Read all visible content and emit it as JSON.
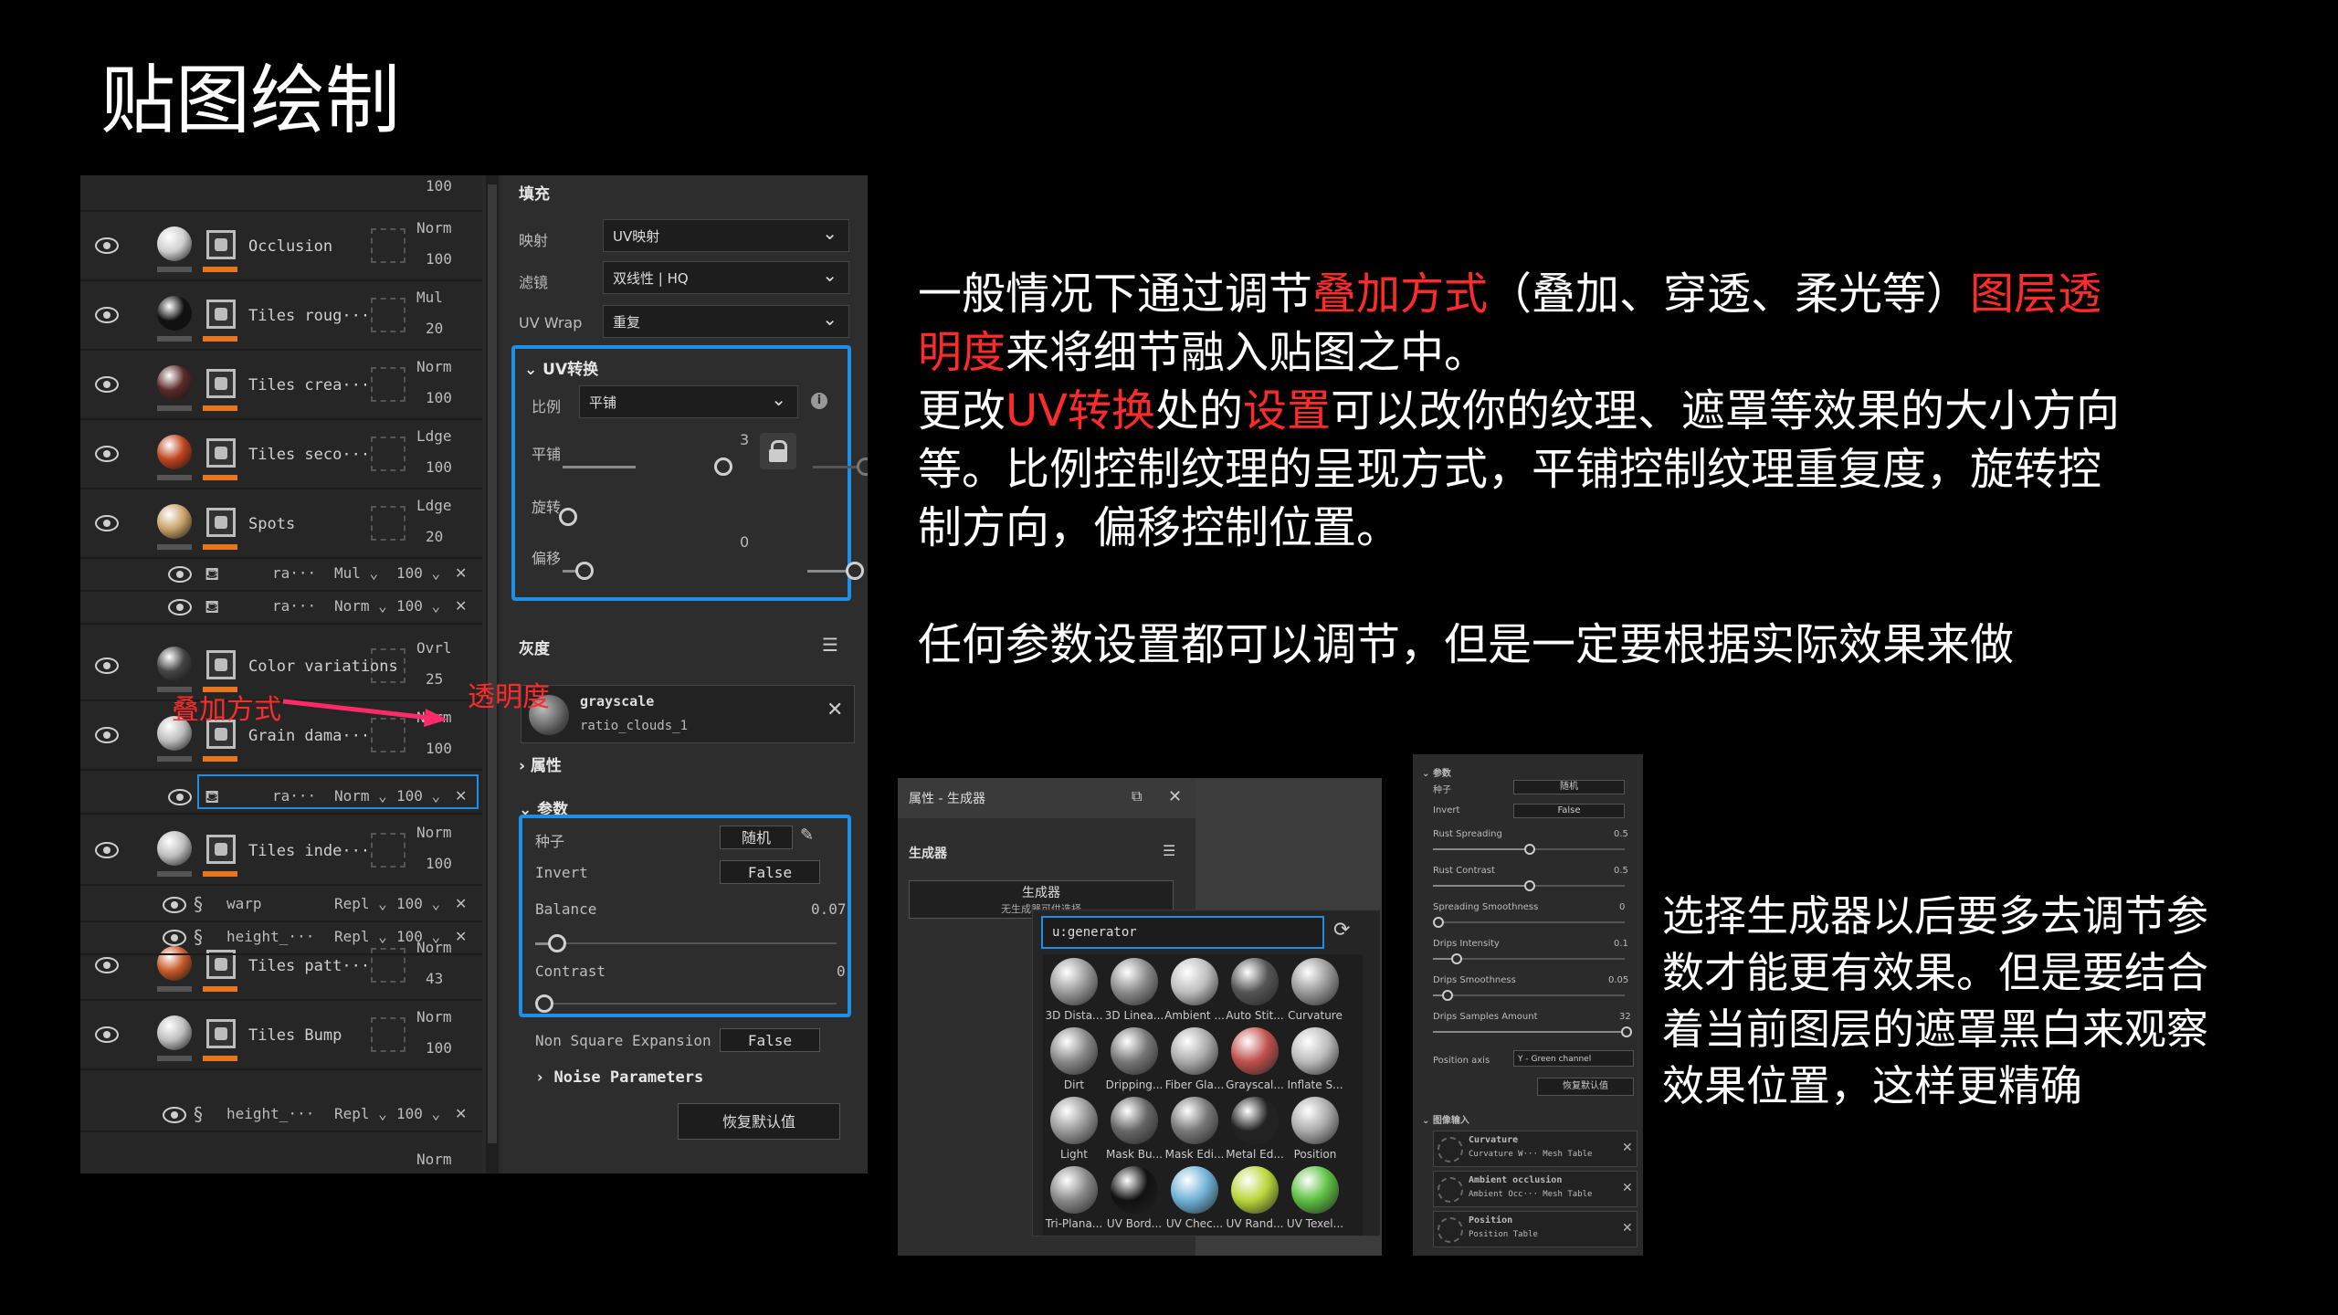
{
  "slide": {
    "title": "贴图绘制",
    "para1": [
      {
        "text": "一般情况下通过调节",
        "red": false
      },
      {
        "text": "叠加方式",
        "red": true
      },
      {
        "text": "（叠加、穿透、柔光等）",
        "red": false
      },
      {
        "text": "图层透",
        "red": true
      }
    ],
    "para2": [
      {
        "text": "明度",
        "red": true
      },
      {
        "text": "来将细节融入贴图之中。",
        "red": false
      }
    ],
    "para3": [
      {
        "text": "更改",
        "red": false
      },
      {
        "text": "UV转换",
        "red": true
      },
      {
        "text": "处的",
        "red": false
      },
      {
        "text": "设置",
        "red": true
      },
      {
        "text": "可以改你的纹理、遮罩等效果的大小方向",
        "red": false
      }
    ],
    "para4": "等。比例控制纹理的呈现方式，平铺控制纹理重复度，旋转控",
    "para5": "制方向，偏移控制位置。",
    "para6": "任何参数设置都可以调节，但是一定要根据实际效果来做",
    "bottom_lines": [
      "选择生成器以后要多去调节参",
      "数才能更有效果。但是要结合",
      "着当前图层的遮罩黑白来观察",
      "效果位置，这样更精确"
    ],
    "annotations": {
      "blend": "叠加方式",
      "opacity": "透明度"
    },
    "colors": {
      "red": "#ff2a2a",
      "blue": "#1e8fe8",
      "orange": "#e8761e"
    }
  },
  "layers": [
    {
      "name": "",
      "blend": "",
      "value": "100",
      "top": 0
    },
    {
      "name": "Occlusion",
      "blend": "Norm",
      "value": "100"
    },
    {
      "name": "Tiles roug···",
      "blend": "Mul",
      "value": "20"
    },
    {
      "name": "Tiles crea···",
      "blend": "Norm",
      "value": "100"
    },
    {
      "name": "Tiles seco···",
      "blend": "Ldge",
      "value": "100"
    },
    {
      "name": "Spots",
      "blend": "Ldge",
      "value": "20"
    },
    {
      "name": "Color variations",
      "blend": "Ovrl",
      "value": "25"
    },
    {
      "name": "Grain dama···",
      "blend": "Norm",
      "value": "100"
    },
    {
      "name": "Tiles inde···",
      "blend": "Norm",
      "value": "100"
    },
    {
      "name": "Tiles patt···",
      "blend": "Norm",
      "value": "43"
    },
    {
      "name": "Tiles Bump",
      "blend": "Norm",
      "value": "100"
    },
    {
      "name": "",
      "blend": "Norm",
      "value": ""
    }
  ],
  "sublayers": [
    {
      "name": "ra···",
      "blend": "Mul ⌄",
      "value": "100 ⌄"
    },
    {
      "name": "ra···",
      "blend": "Norm ⌄",
      "value": "100 ⌄"
    },
    {
      "name": "ra···",
      "blend": "Norm ⌄",
      "value": "100 ⌄"
    },
    {
      "name": "warp",
      "blend": "Repl ⌄",
      "value": "100 ⌄"
    },
    {
      "name": "height_···",
      "blend": "Repl ⌄",
      "value": "100 ⌄"
    },
    {
      "name": "height_···",
      "blend": "Repl ⌄",
      "value": "100 ⌄"
    }
  ],
  "props": {
    "fill": "填充",
    "mapping_label": "映射",
    "mapping_value": "UV映射",
    "filter_label": "滤镜",
    "filter_value": "双线性 | HQ",
    "uvwrap_label": "UV Wrap",
    "uvwrap_value": "重复",
    "uvtransform": "UV转换",
    "scale_label": "比例",
    "scale_value": "平铺",
    "tiling_label": "平铺",
    "tiling_a": "3",
    "tiling_b": "3",
    "rotation_label": "旋转",
    "rotation_value": "0",
    "offset_label": "偏移",
    "offset_a": "0",
    "offset_b": "0",
    "gray_head": "灰度",
    "gray_name": "grayscale",
    "gray_file": "ratio_clouds_1",
    "attributes": "属性",
    "params": "参数",
    "seed_label": "种子",
    "seed_value": "随机",
    "invert_label": "Invert",
    "invert_value": "False",
    "balance_label": "Balance",
    "balance_value": "0.07",
    "contrast_label": "Contrast",
    "contrast_value": "0",
    "nse_label": "Non Square Expansion",
    "nse_value": "False",
    "noise_params": "Noise Parameters",
    "reset": "恢复默认值"
  },
  "generator": {
    "title": "属性 - 生成器",
    "section": "生成器",
    "button": "生成器",
    "button_sub": "无生成器可供选择",
    "search": "u:generator",
    "items": [
      "3D Dista...",
      "3D Linea...",
      "Ambient ...",
      "Auto Stit...",
      "Curvature",
      "Dirt",
      "Dripping...",
      "Fiber Gla...",
      "Grayscal...",
      "Inflate S...",
      "Light",
      "Mask Bu...",
      "Mask Edi...",
      "Metal Ed...",
      "Position",
      "Tri-Plana...",
      "UV Bord...",
      "UV Chec...",
      "UV Rand...",
      "UV Texel..."
    ]
  },
  "gparams": {
    "head": "参数",
    "seed": "种子",
    "seed_v": "随机",
    "invert": "Invert",
    "invert_v": "False",
    "rust_spreading": "Rust Spreading",
    "rust_spreading_v": "0.5",
    "rust_contrast": "Rust Contrast",
    "rust_contrast_v": "0.5",
    "spreading_smooth": "Spreading Smoothness",
    "spreading_smooth_v": "0",
    "drips_intensity": "Drips Intensity",
    "drips_intensity_v": "0.1",
    "drips_smooth": "Drips Smoothness",
    "drips_smooth_v": "0.05",
    "drips_samples": "Drips Samples Amount",
    "drips_samples_v": "32",
    "position_axis": "Position axis",
    "position_axis_v": "Y - Green channel",
    "reset": "恢复默认值",
    "image_input": "图像输入",
    "inputs": [
      {
        "name": "Curvature",
        "sub": "Curvature W··· Mesh Table"
      },
      {
        "name": "Ambient occlusion",
        "sub": "Ambient Occ··· Mesh Table"
      },
      {
        "name": "Position",
        "sub": "Position Table"
      }
    ]
  }
}
